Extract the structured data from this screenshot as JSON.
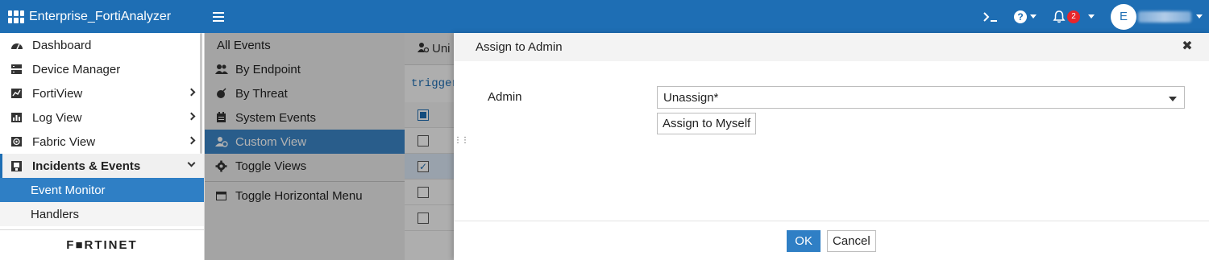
{
  "topbar": {
    "app_title": "Enterprise_FortiAnalyzer",
    "notification_count": "2",
    "avatar_initial": "E",
    "colors": {
      "bar": "#1e6eb4",
      "badge": "#e8252b"
    }
  },
  "sidebar": {
    "items": [
      {
        "label": "Dashboard",
        "icon": "dashboard-icon"
      },
      {
        "label": "Device Manager",
        "icon": "device-manager-icon"
      },
      {
        "label": "FortiView",
        "icon": "fortiview-icon"
      },
      {
        "label": "Log View",
        "icon": "log-view-icon"
      },
      {
        "label": "Fabric View",
        "icon": "fabric-view-icon"
      },
      {
        "label": "Incidents & Events",
        "icon": "incidents-icon"
      }
    ],
    "subitems": [
      {
        "label": "Event Monitor"
      },
      {
        "label": "Handlers"
      }
    ],
    "logo_text": "F■RTINET"
  },
  "submenu": {
    "items": [
      {
        "label": "All Events"
      },
      {
        "label": "By Endpoint"
      },
      {
        "label": "By Threat"
      },
      {
        "label": "System Events"
      },
      {
        "label": "Custom View"
      },
      {
        "label": "Toggle Views"
      },
      {
        "label": "Toggle Horizontal Menu"
      }
    ]
  },
  "background": {
    "toolbar_label": "Uni",
    "filter_text": "trigger"
  },
  "dialog": {
    "title": "Assign to Admin",
    "admin_label": "Admin",
    "admin_value": "Unassign*",
    "assign_self_label": "Assign to Myself",
    "ok_label": "OK",
    "cancel_label": "Cancel"
  }
}
